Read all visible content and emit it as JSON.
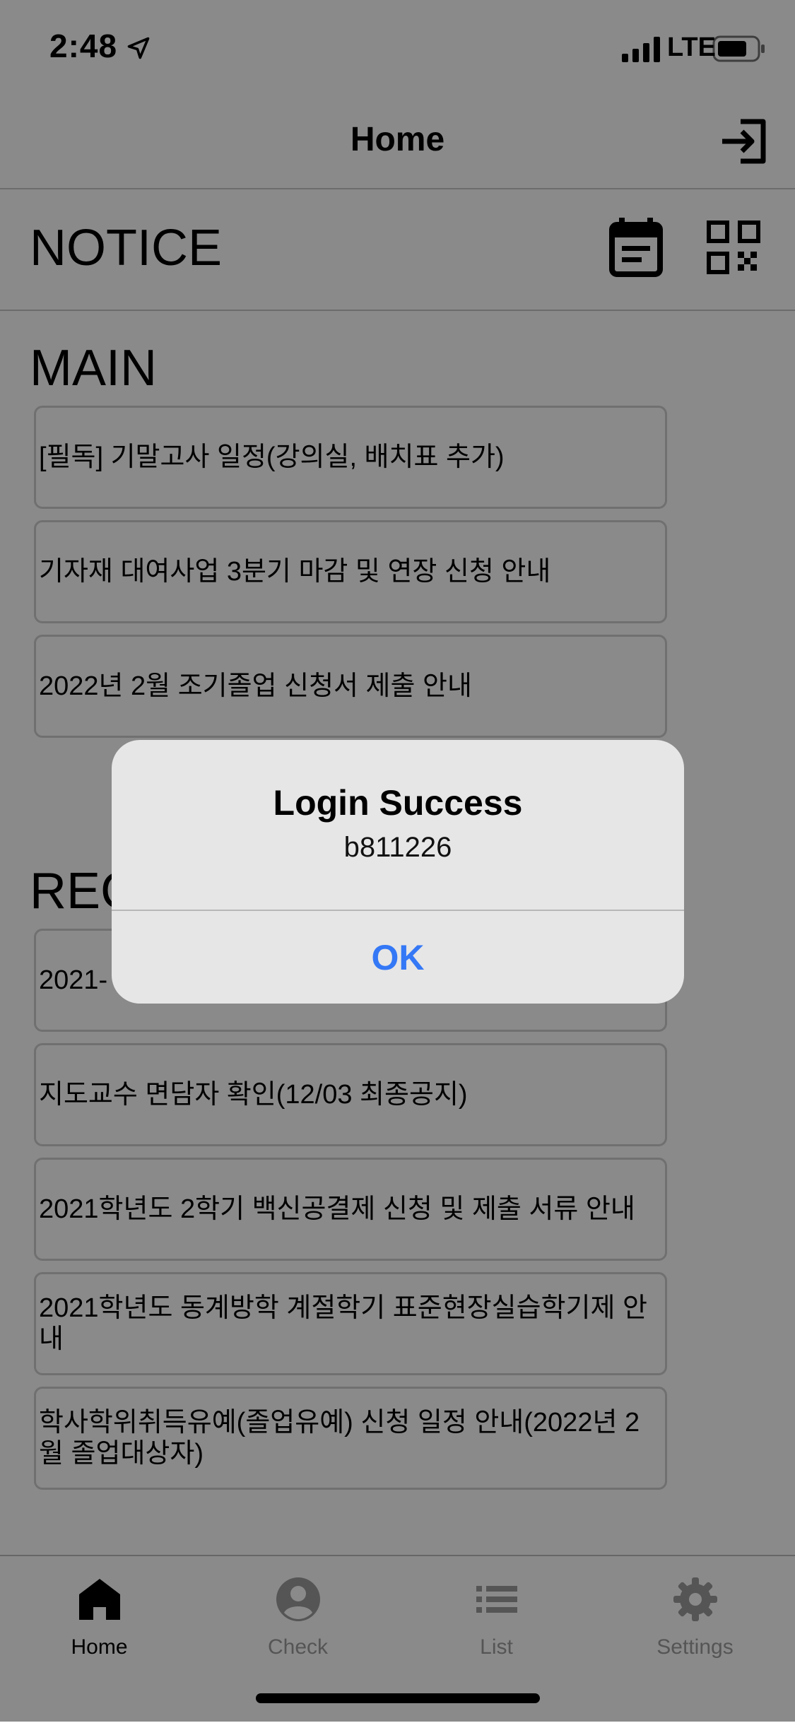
{
  "status": {
    "time": "2:48",
    "network": "LTE"
  },
  "nav": {
    "title": "Home"
  },
  "notice": {
    "title": "NOTICE"
  },
  "main": {
    "title": "MAIN",
    "items": [
      "[필독] 기말고사 일정(강의실, 배치표 추가)",
      "기자재 대여사업 3분기 마감 및 연장 신청 안내",
      "2022년 2월 조기졸업 신청서 제출 안내"
    ]
  },
  "recent": {
    "title": "REC",
    "items": [
      "2021-",
      "지도교수 면담자 확인(12/03 최종공지)",
      "2021학년도 2학기 백신공결제 신청 및 제출 서류 안내",
      "2021학년도 동계방학 계절학기 표준현장실습학기제 안내",
      "학사학위취득유예(졸업유예) 신청 일정 안내(2022년 2월 졸업대상자)"
    ]
  },
  "tabs": [
    {
      "label": "Home",
      "icon": "home-icon",
      "active": true
    },
    {
      "label": "Check",
      "icon": "account-circle-icon",
      "active": false
    },
    {
      "label": "List",
      "icon": "list-icon",
      "active": false
    },
    {
      "label": "Settings",
      "icon": "gear-icon",
      "active": false
    }
  ],
  "alert": {
    "title": "Login Success",
    "message": "b811226",
    "ok_label": "OK"
  },
  "colors": {
    "accent": "#3478f6",
    "inactive_tab": "#9e9e9e",
    "card_border": "#cfcfcf"
  }
}
